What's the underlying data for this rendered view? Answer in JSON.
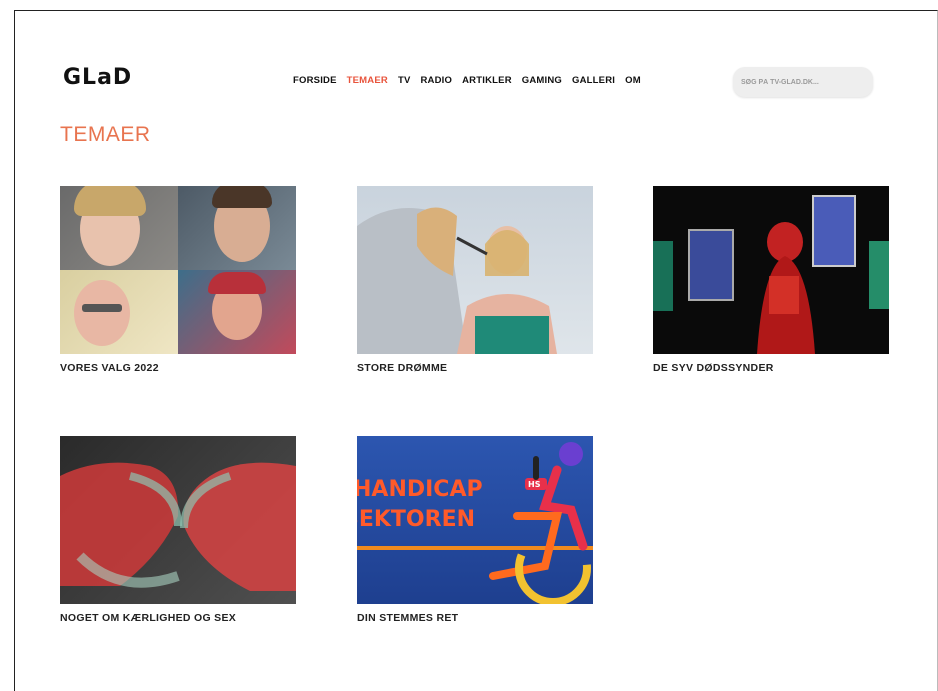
{
  "header": {
    "logo": "GLaD",
    "nav": [
      "FORSIDE",
      "TEMAER",
      "TV",
      "RADIO",
      "ARTIKLER",
      "GAMING",
      "GALLERI",
      "OM"
    ],
    "active_nav": "TEMAER",
    "search_placeholder": "SØG PÅ TV-GLAD.DK..."
  },
  "page": {
    "title": "TEMAER"
  },
  "cards": [
    {
      "label": "VORES VALG 2022"
    },
    {
      "label": "STORE DRØMME"
    },
    {
      "label": "DE SYV DØDSSYNDER"
    },
    {
      "label": "NOGET OM KÆRLIGHED OG SEX"
    },
    {
      "label": "DIN STEMMES RET",
      "image_text": [
        "HANDICAP",
        "SEKTOREN"
      ],
      "badge": "HS"
    }
  ],
  "colors": {
    "accent": "#e8543c",
    "title": "#e8744f"
  }
}
